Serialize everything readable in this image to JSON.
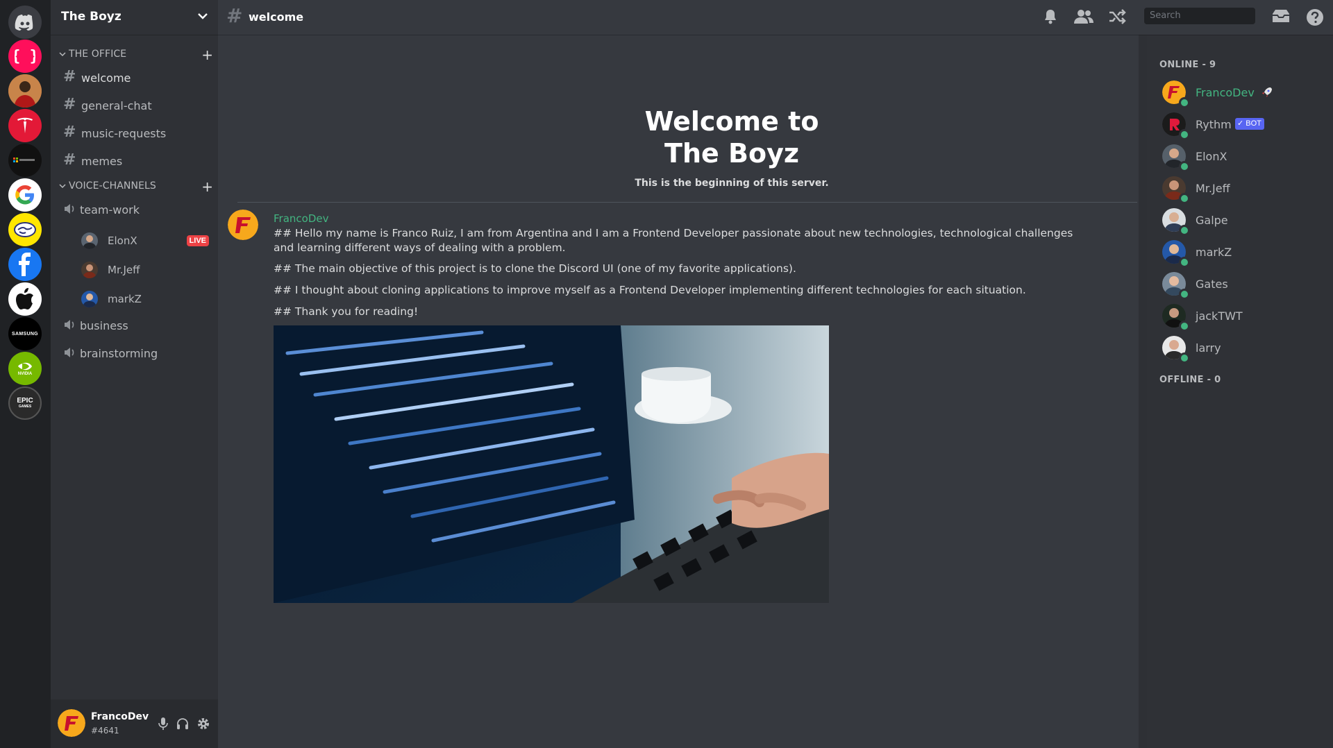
{
  "server": {
    "name": "The Boyz",
    "rail_icons": [
      "discord-home",
      "code-braces",
      "person",
      "tesla",
      "microsoft",
      "google",
      "handshake",
      "facebook",
      "apple",
      "samsung",
      "nvidia",
      "epic-games"
    ],
    "rail_labels": {
      "samsung": "SAMSUNG",
      "nvidia": "NVIDIA",
      "epic": "EPIC",
      "epic_sub": "GAMES"
    }
  },
  "sidebar": {
    "categories": [
      {
        "label": "THE OFFICE"
      },
      {
        "label": "VOICE-CHANNELS"
      }
    ],
    "text_channels": [
      {
        "name": "welcome"
      },
      {
        "name": "general-chat"
      },
      {
        "name": "music-requests"
      },
      {
        "name": "memes"
      }
    ],
    "voice_channels": [
      {
        "name": "team-work"
      },
      {
        "name": "business"
      },
      {
        "name": "brainstorming"
      }
    ],
    "voice_users": [
      {
        "name": "ElonX",
        "badge": "LIVE"
      },
      {
        "name": "Mr.Jeff"
      },
      {
        "name": "markZ"
      }
    ]
  },
  "user": {
    "name": "FrancoDev",
    "discriminator": "#4641"
  },
  "channel": {
    "name": "welcome",
    "search_placeholder": "Search"
  },
  "welcome": {
    "title_line1": "Welcome to",
    "title_line2": "The Boyz",
    "subtitle": "This is the beginning of this server."
  },
  "message": {
    "author": "FrancoDev",
    "lines": [
      "## Hello my name is Franco Ruiz, I am from Argentina and I am a Frontend Developer passionate about new technologies, technological challenges and learning different ways of dealing with a problem.",
      "## The main objective of this project is to clone the Discord UI (one of my favorite applications).",
      "## I thought about cloning applications to improve myself as a Frontend Developer implementing different technologies for each situation.",
      "## Thank you for reading!"
    ]
  },
  "members": {
    "online_header": "ONLINE - 9",
    "offline_header": "OFFLINE - 0",
    "list": [
      {
        "name": "FrancoDev"
      },
      {
        "name": "Rythm",
        "badge": "BOT"
      },
      {
        "name": "ElonX"
      },
      {
        "name": "Mr.Jeff"
      },
      {
        "name": "Galpe"
      },
      {
        "name": "markZ"
      },
      {
        "name": "Gates"
      },
      {
        "name": "jackTWT"
      },
      {
        "name": "larry"
      }
    ]
  },
  "colors": {
    "online": "#43b581",
    "live": "#ed4245",
    "bot": "#5865f2",
    "bg_main": "#36393f",
    "bg_sidebar": "#2f3136",
    "bg_rail": "#202225"
  }
}
